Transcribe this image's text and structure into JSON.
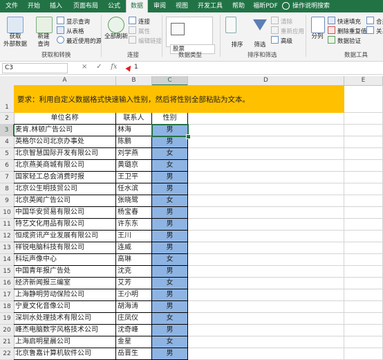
{
  "ribbon_tabs": [
    "文件",
    "开始",
    "插入",
    "页面布局",
    "公式",
    "数据",
    "审阅",
    "视图",
    "开发工具",
    "帮助",
    "福昕PDF"
  ],
  "active_tab": "数据",
  "tell_me": "操作说明搜索",
  "groups": {
    "get_transform": {
      "label": "获取和转换",
      "get_data": "获取\n外部数据",
      "new_query": "新建\n查询",
      "show_queries": "显示查询",
      "from_table": "从表格",
      "recent_sources": "最近使用的源"
    },
    "connections": {
      "label": "连接",
      "refresh_all": "全部刷新",
      "connections": "连接",
      "properties": "属性",
      "edit_links": "编辑链接"
    },
    "data_types": {
      "label": "数据类型",
      "stocks": "股票"
    },
    "sort_filter": {
      "label": "排序和筛选",
      "sort": "排序",
      "filter": "筛选",
      "clear": "清除",
      "reapply": "重新应用",
      "advanced": "高级"
    },
    "data_tools": {
      "label": "数据工具",
      "split": "分列",
      "flash_fill": "快速填充",
      "remove_duplicates": "删除重复值",
      "validation": "数据验证",
      "combine": "合并",
      "relations": "关系"
    }
  },
  "formula_bar": {
    "name_box": "C3",
    "cancel": "×",
    "enter": "✓",
    "fx": "fx",
    "value": "1"
  },
  "columns": [
    "A",
    "B",
    "C",
    "D",
    "E"
  ],
  "rows": [
    "1",
    "2",
    "3",
    "4",
    "5",
    "6",
    "7",
    "8",
    "9",
    "10",
    "11",
    "12",
    "13",
    "14",
    "15",
    "16",
    "17",
    "18",
    "19",
    "20",
    "21",
    "22"
  ],
  "banner_text": "要求：利用自定义数据格式快速输入性别，然后将性别全部粘贴为文本。",
  "table": {
    "headers": [
      "单位名称",
      "联系人",
      "性别"
    ],
    "rows": [
      [
        "麦肯.林顿广告公司",
        "林海",
        "男"
      ],
      [
        "英格尔公司北京办事处",
        "陈鹏",
        "男"
      ],
      [
        "北京智慧国际开发有限公司",
        "刘学燕",
        "女"
      ],
      [
        "北京燕美商城有限公司",
        "黄璐京",
        "女"
      ],
      [
        "国家轻工总会消费时报",
        "王卫平",
        "男"
      ],
      [
        "北京公生明技贸公司",
        "任水滨",
        "男"
      ],
      [
        "北京英闻广告公司",
        "张晓鹭",
        "女"
      ],
      [
        "中国华安贸易有限公司",
        "杨宝春",
        "男"
      ],
      [
        "特艺文化用品有限公司",
        "许东东",
        "男"
      ],
      [
        "恒成资讯产业发展有限公司",
        "王川",
        "男"
      ],
      [
        "祥锐电脑科技有限公司",
        "连威",
        "男"
      ],
      [
        "科坛声像中心",
        "高琳",
        "女"
      ],
      [
        "中国青年报广告处",
        "沈克",
        "男"
      ],
      [
        "经济新闻报三编室",
        "艾芳",
        "女"
      ],
      [
        "上海静明劳动保险公司",
        "王小明",
        "男"
      ],
      [
        "宁夏文化音像公司",
        "胡海涛",
        "男"
      ],
      [
        "深圳水处理技术有限公司",
        "庄凤仪",
        "女"
      ],
      [
        "峰杰电脑数字风格技术公司",
        "沈奇峰",
        "男"
      ],
      [
        "上海启明星晨公司",
        "金星",
        "女"
      ],
      [
        "北京鲁嘉计算机软件公司",
        "岳晋生",
        "男"
      ]
    ]
  },
  "colors": {
    "ribbon_green": "#217346",
    "banner_fill": "#ffc000",
    "gender_fill": "#8eb4e3"
  }
}
